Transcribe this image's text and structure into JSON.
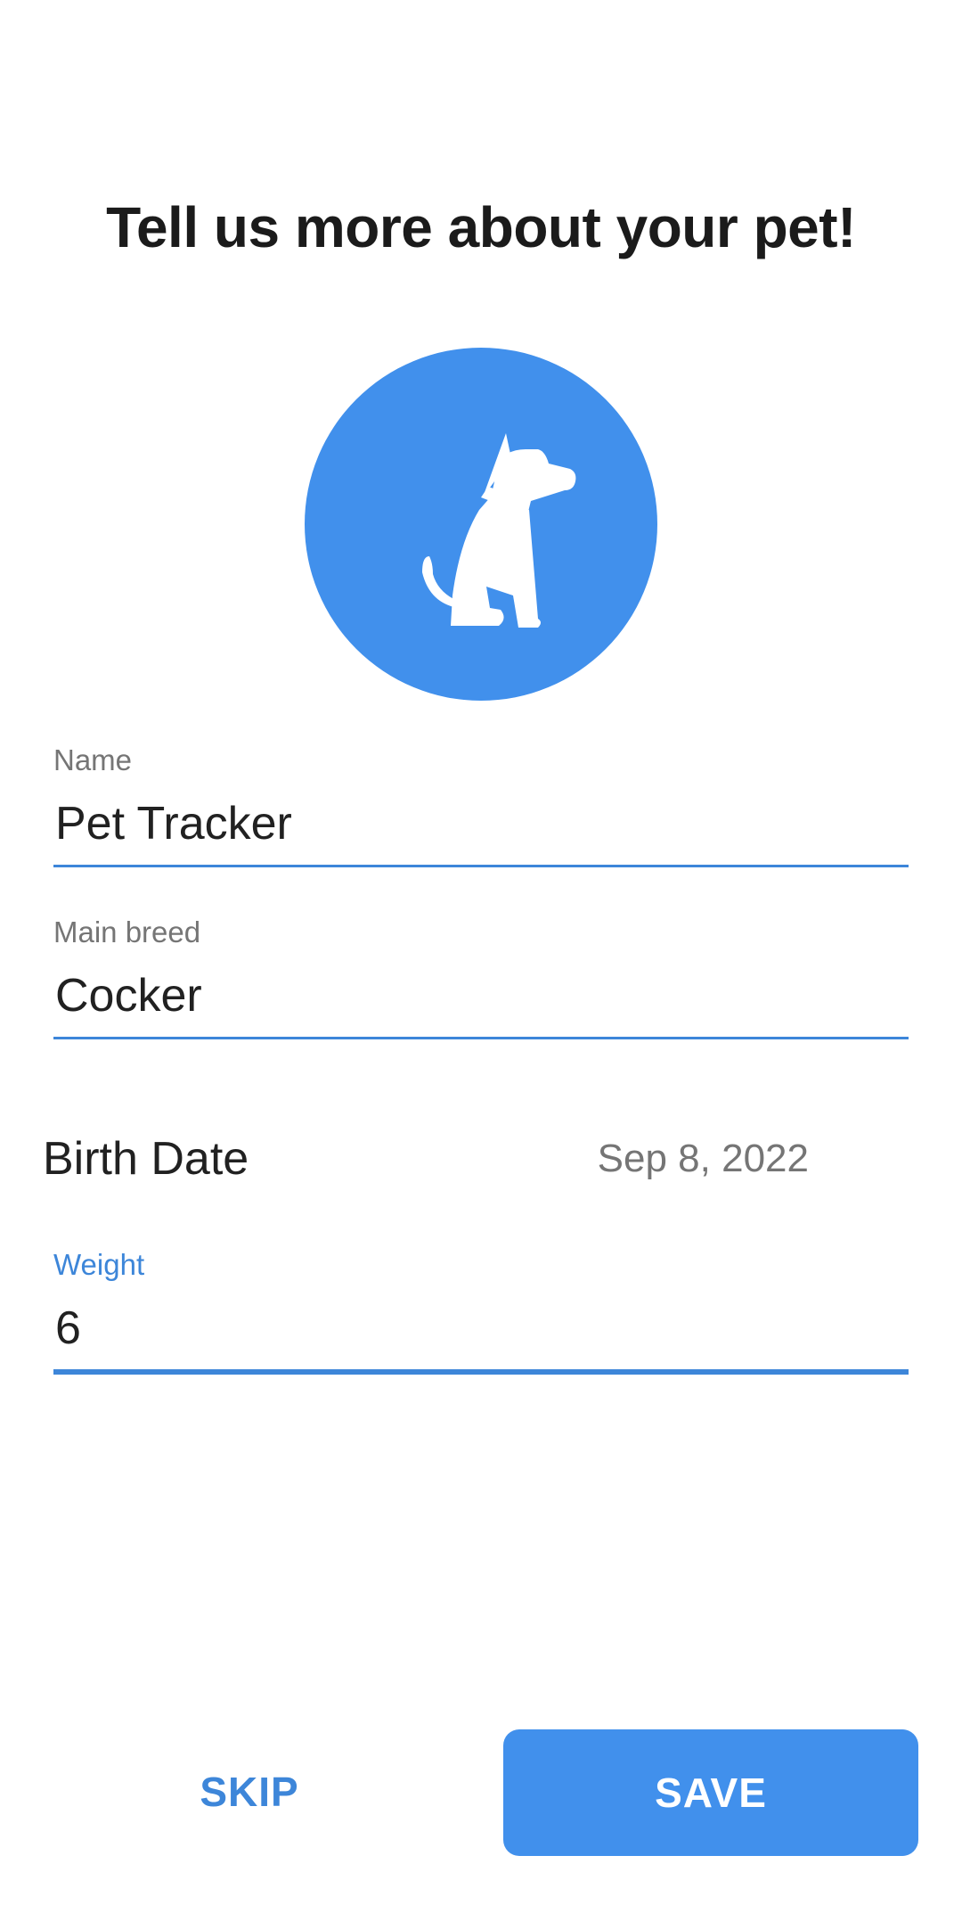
{
  "header": {
    "title": "Tell us more about your pet!"
  },
  "avatar": {
    "icon": "dog-sitting-icon",
    "background_color": "#4190ec"
  },
  "form": {
    "name": {
      "label": "Name",
      "value": "Pet Tracker"
    },
    "breed": {
      "label": "Main breed",
      "value": "Cocker"
    },
    "birth_date": {
      "label": "Birth Date",
      "value": "Sep 8, 2022"
    },
    "weight": {
      "label": "Weight",
      "value": "6",
      "focused": true
    }
  },
  "actions": {
    "skip_label": "SKIP",
    "save_label": "SAVE"
  },
  "colors": {
    "accent": "#3d86d9",
    "primary_button": "#4190ec"
  }
}
